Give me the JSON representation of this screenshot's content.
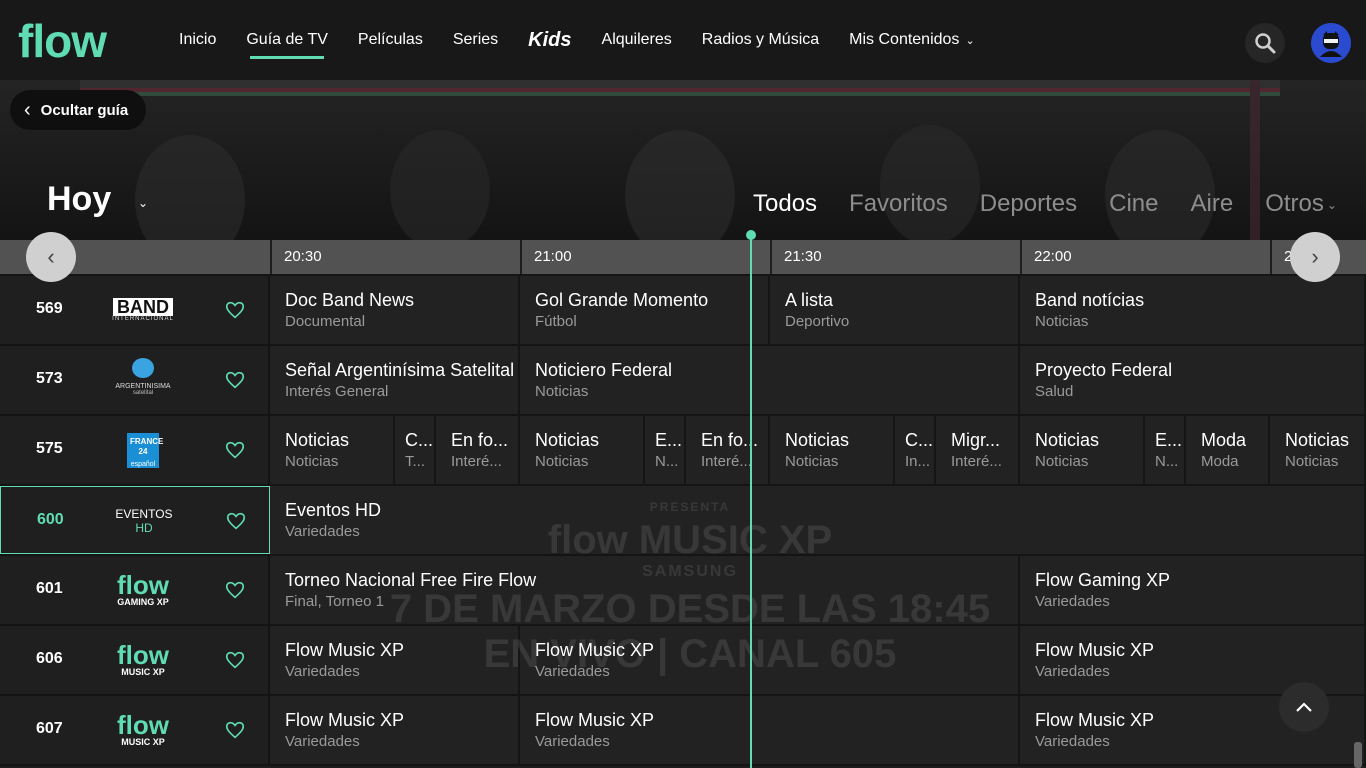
{
  "app": {
    "logo": "flow"
  },
  "nav": {
    "items": [
      {
        "label": "Inicio",
        "active": false
      },
      {
        "label": "Guía de TV",
        "active": true
      },
      {
        "label": "Películas",
        "active": false
      },
      {
        "label": "Series",
        "active": false
      },
      {
        "label": "Kids",
        "active": false
      },
      {
        "label": "Alquileres",
        "active": false
      },
      {
        "label": "Radios y Música",
        "active": false
      },
      {
        "label": "Mis Contenidos",
        "active": false
      }
    ]
  },
  "hero": {
    "hide_guide": "Ocultar guía",
    "day": "Hoy",
    "filters": [
      "Todos",
      "Favoritos",
      "Deportes",
      "Cine",
      "Aire",
      "Otros"
    ]
  },
  "timeline": {
    "slots": [
      "20:30",
      "21:00",
      "21:30",
      "22:00",
      "2"
    ]
  },
  "poster": {
    "presenta": "PRESENTA",
    "brand": "flow MUSIC XP",
    "sponsor": "SAMSUNG",
    "line1": "7 DE MARZO DESDE LAS 18:45",
    "line2": "EN VIVO | CANAL 605"
  },
  "channels": [
    {
      "number": "569",
      "logo_text": "BAND",
      "logo_sub": "INTERNACIONAL"
    },
    {
      "number": "573",
      "logo_text": "ARGENTINISIMA",
      "logo_sub": "satelital"
    },
    {
      "number": "575",
      "logo_text": "FRANCE 24",
      "logo_sub": "español"
    },
    {
      "number": "600",
      "logo_text": "EVENTOS",
      "logo_sub": "HD"
    },
    {
      "number": "601",
      "logo_text": "flow",
      "logo_sub": "GAMING XP"
    },
    {
      "number": "606",
      "logo_text": "flow",
      "logo_sub": "MUSIC XP"
    },
    {
      "number": "607",
      "logo_text": "flow",
      "logo_sub": "MUSIC XP"
    }
  ],
  "programs": [
    [
      {
        "title": "Doc Band News",
        "genre": "Documental"
      },
      {
        "title": "Gol Grande Momento",
        "genre": "Fútbol"
      },
      {
        "title": "A lista",
        "genre": "Deportivo"
      },
      {
        "title": "Band notícias",
        "genre": "Noticias"
      }
    ],
    [
      {
        "title": "Señal Argentinísima Satelital",
        "genre": "Interés General"
      },
      {
        "title": "Noticiero Federal",
        "genre": "Noticias"
      },
      {
        "title": "Proyecto Federal",
        "genre": "Salud"
      }
    ],
    [
      {
        "title": "Noticias",
        "genre": "Noticias"
      },
      {
        "title": "C...",
        "genre": "T..."
      },
      {
        "title": "En fo...",
        "genre": "Interé..."
      },
      {
        "title": "Noticias",
        "genre": "Noticias"
      },
      {
        "title": "E...",
        "genre": "N..."
      },
      {
        "title": "En fo...",
        "genre": "Interé..."
      },
      {
        "title": "Noticias",
        "genre": "Noticias"
      },
      {
        "title": "C...",
        "genre": "In..."
      },
      {
        "title": "Migr...",
        "genre": "Interé..."
      },
      {
        "title": "Noticias",
        "genre": "Noticias"
      },
      {
        "title": "E...",
        "genre": "N..."
      },
      {
        "title": "Moda",
        "genre": "Moda"
      },
      {
        "title": "Noticias",
        "genre": "Noticias"
      }
    ],
    [
      {
        "title": "Eventos HD",
        "genre": "Variedades"
      }
    ],
    [
      {
        "title": "Torneo Nacional Free Fire Flow",
        "genre": "Final, Torneo 1"
      },
      {
        "title": "Flow Gaming XP",
        "genre": "Variedades"
      }
    ],
    [
      {
        "title": "Flow Music XP",
        "genre": "Variedades"
      },
      {
        "title": "Flow Music XP",
        "genre": "Variedades"
      },
      {
        "title": "Flow Music XP",
        "genre": "Variedades"
      }
    ],
    [
      {
        "title": "Flow Music XP",
        "genre": "Variedades"
      },
      {
        "title": "Flow Music XP",
        "genre": "Variedades"
      },
      {
        "title": "Flow Music XP",
        "genre": "Variedades"
      }
    ]
  ],
  "colors": {
    "accent": "#5fdcb3",
    "background": "#1d1d1d",
    "timebar": "#525252"
  },
  "icons": [
    "search-icon",
    "avatar-icon",
    "chevron-left-icon",
    "chevron-right-icon",
    "chevron-down-icon",
    "heart-icon",
    "chevron-up-icon"
  ]
}
